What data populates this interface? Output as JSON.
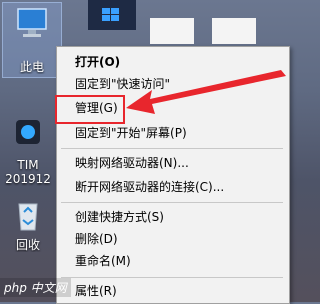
{
  "desktop": {
    "icons": [
      {
        "label": "此电",
        "icon": "computer-icon"
      },
      {
        "label": "TIM",
        "icon": "tim-icon"
      },
      {
        "label": "201912",
        "icon": "tim-icon"
      },
      {
        "label": "回收",
        "icon": "recycle-bin-icon"
      }
    ],
    "watermark": "php 中文网"
  },
  "context_menu": {
    "items": [
      {
        "label": "打开(O)",
        "bold": true
      },
      {
        "label": "固定到\"快速访问\""
      },
      {
        "label": "管理(G)"
      },
      {
        "label": "固定到\"开始\"屏幕(P)"
      },
      {
        "label": "映射网络驱动器(N)..."
      },
      {
        "label": "断开网络驱动器的连接(C)..."
      },
      {
        "label": "创建快捷方式(S)"
      },
      {
        "label": "删除(D)"
      },
      {
        "label": "重命名(M)"
      },
      {
        "label": "属性(R)"
      }
    ]
  },
  "colors": {
    "highlight": "#e8262d",
    "menu_bg": "#f2f2f2"
  }
}
